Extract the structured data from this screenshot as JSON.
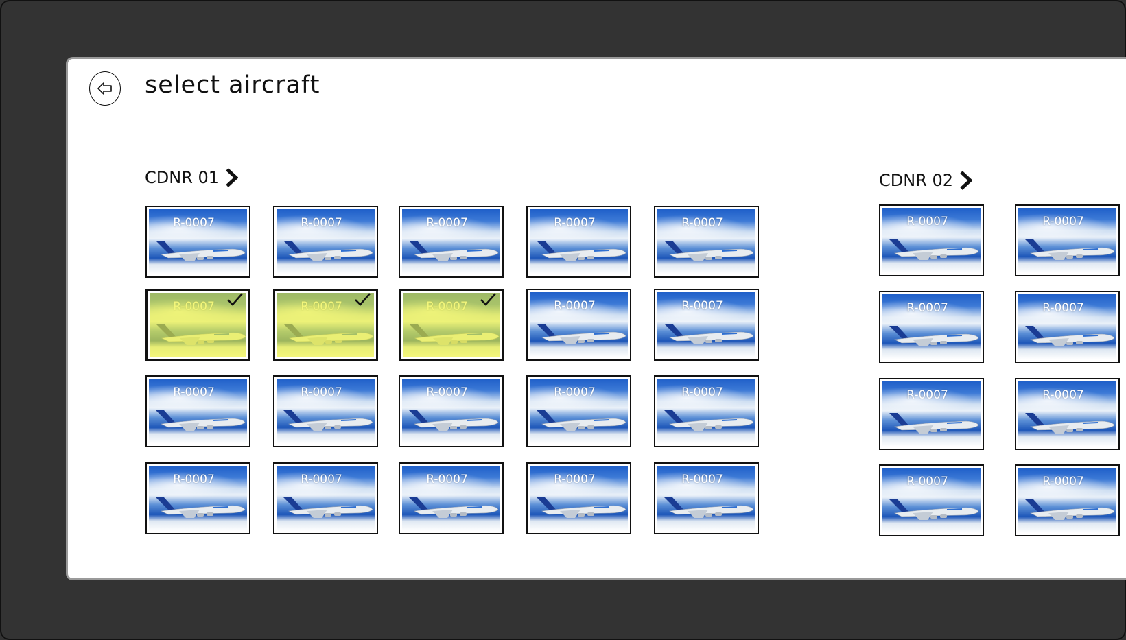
{
  "header": {
    "title": "select aircraft",
    "back_icon": "back-arrow-icon"
  },
  "groups": [
    {
      "label": "CDNR 01",
      "tiles": [
        {
          "reg": "R-0007",
          "selected": false
        },
        {
          "reg": "R-0007",
          "selected": false
        },
        {
          "reg": "R-0007",
          "selected": false
        },
        {
          "reg": "R-0007",
          "selected": false
        },
        {
          "reg": "R-0007",
          "selected": false
        },
        {
          "reg": "R-0007",
          "selected": true
        },
        {
          "reg": "R-0007",
          "selected": true
        },
        {
          "reg": "R-0007",
          "selected": true
        },
        {
          "reg": "R-0007",
          "selected": false
        },
        {
          "reg": "R-0007",
          "selected": false
        },
        {
          "reg": "R-0007",
          "selected": false
        },
        {
          "reg": "R-0007",
          "selected": false
        },
        {
          "reg": "R-0007",
          "selected": false
        },
        {
          "reg": "R-0007",
          "selected": false
        },
        {
          "reg": "R-0007",
          "selected": false
        },
        {
          "reg": "R-0007",
          "selected": false
        },
        {
          "reg": "R-0007",
          "selected": false
        },
        {
          "reg": "R-0007",
          "selected": false
        },
        {
          "reg": "R-0007",
          "selected": false
        },
        {
          "reg": "R-0007",
          "selected": false
        }
      ]
    },
    {
      "label": "CDNR 02",
      "tiles": [
        {
          "reg": "R-0007",
          "selected": false
        },
        {
          "reg": "R-0007",
          "selected": false
        },
        {
          "reg": "R-0007",
          "selected": false
        },
        {
          "reg": "R-0007",
          "selected": false
        },
        {
          "reg": "R-0007",
          "selected": false
        },
        {
          "reg": "R-0007",
          "selected": false
        },
        {
          "reg": "R-0007",
          "selected": false
        },
        {
          "reg": "R-0007",
          "selected": false
        }
      ]
    }
  ],
  "colors": {
    "background": "#333333",
    "card": "#ffffff",
    "selected_overlay": "#ebf028"
  }
}
